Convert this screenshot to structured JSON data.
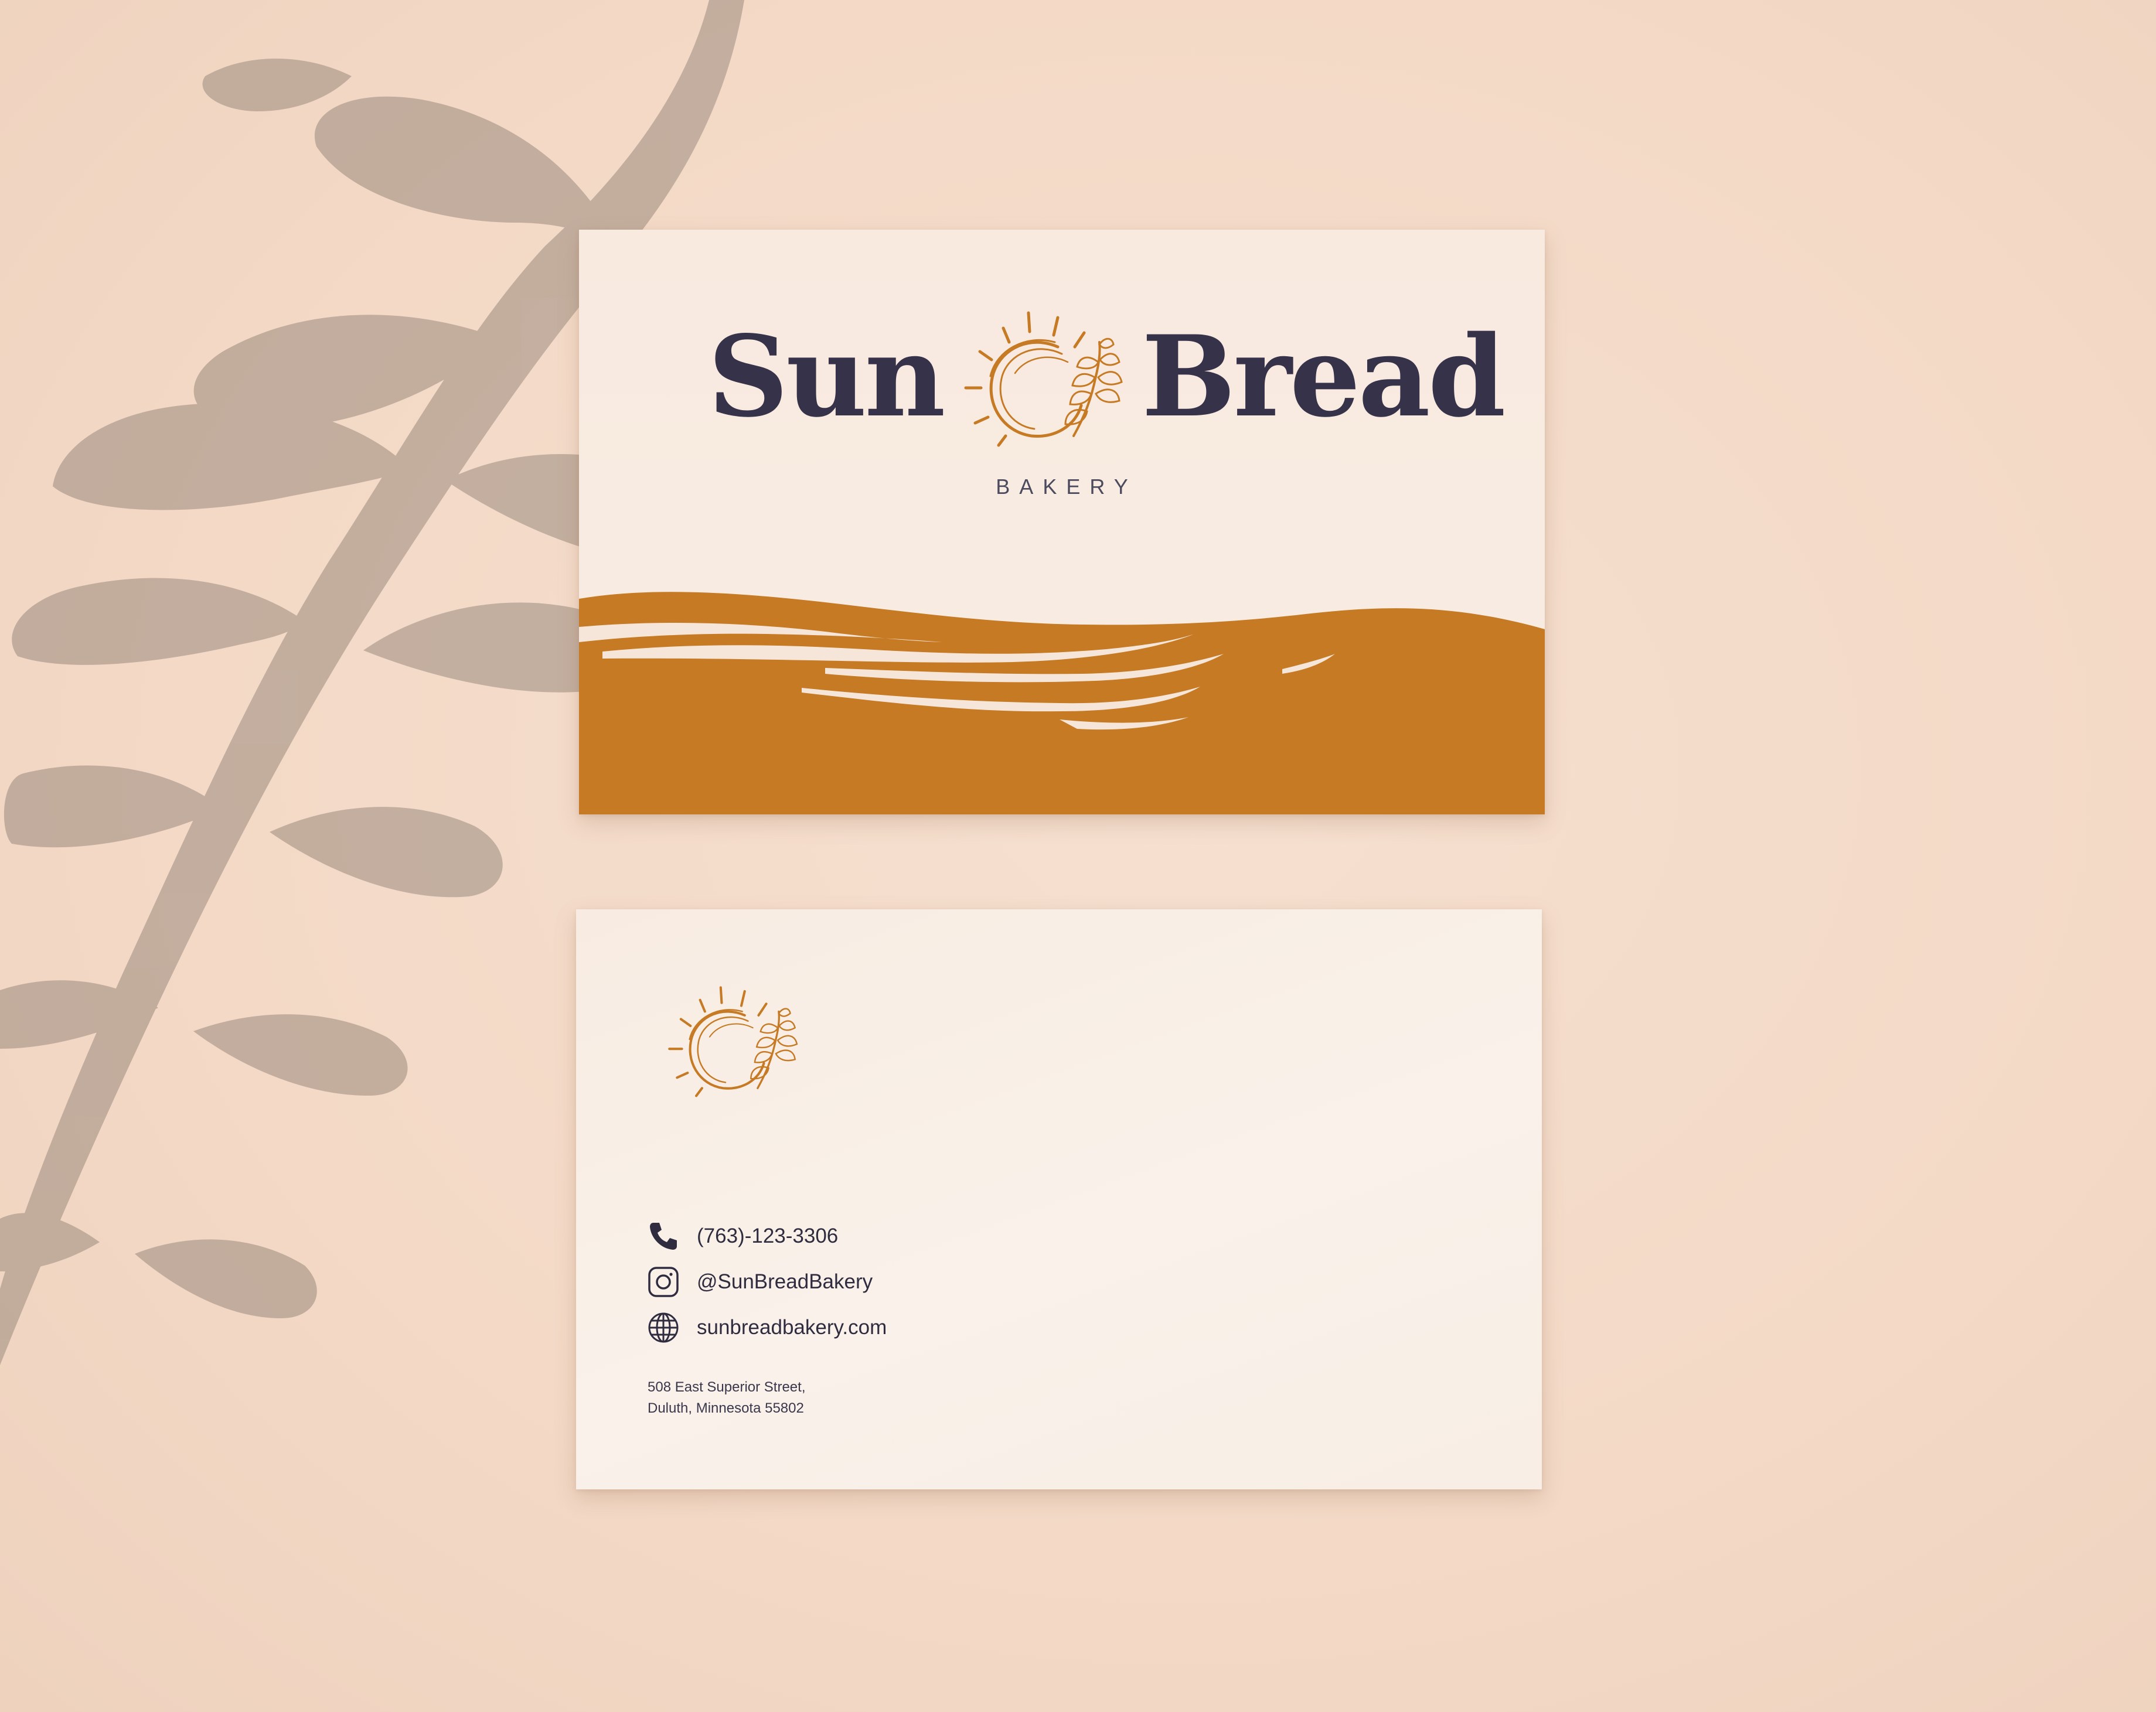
{
  "scene": {
    "background_color": "#f4dcca",
    "shadow_color": "#8a7a6e"
  },
  "front_card": {
    "brand_left": "Sun",
    "brand_right": "Bread",
    "tagline": "BAKERY",
    "logo_icon": "sun-wheat-icon",
    "text_color": "#35324a",
    "accent_color": "#c67a24",
    "card_color": "#f8eadf"
  },
  "back_card": {
    "logo_icon": "sun-wheat-icon",
    "contacts": [
      {
        "icon": "phone-icon",
        "text": "(763)-123-3306"
      },
      {
        "icon": "instagram-icon",
        "text": "@SunBreadBakery"
      },
      {
        "icon": "globe-icon",
        "text": "sunbreadbakery.com"
      }
    ],
    "address_line1": "508 East Superior Street,",
    "address_line2": "Duluth, Minnesota 55802"
  }
}
